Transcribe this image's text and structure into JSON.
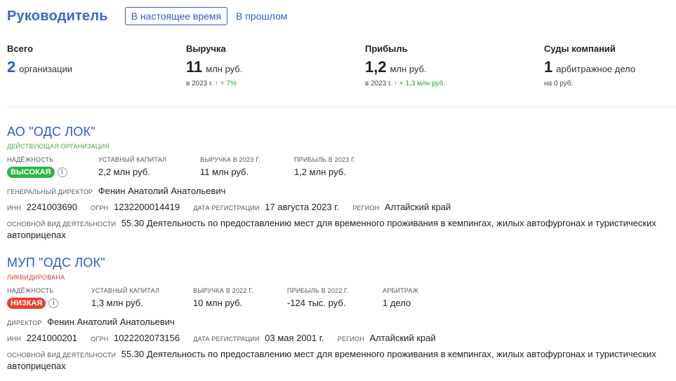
{
  "header": {
    "title": "Руководитель",
    "tabs": [
      {
        "label": "В настоящее время"
      },
      {
        "label": "В прошлом"
      }
    ]
  },
  "stats": {
    "total": {
      "label": "Всего",
      "value": "2",
      "unit": "организации"
    },
    "revenue": {
      "label": "Выручка",
      "value": "11",
      "unit": "млн руб.",
      "year": "в 2023 г.",
      "delta": "↑ + 7%"
    },
    "profit": {
      "label": "Прибыль",
      "value": "1,2",
      "unit": "млн руб.",
      "year": "в 2023 г.",
      "delta": "↑ + 1,3 млн руб."
    },
    "courts": {
      "label": "Суды компаний",
      "value": "1",
      "unit": "арбитражное дело",
      "sub": "на 0 руб."
    }
  },
  "orgs": [
    {
      "name": "АО \"ОДС ЛОК\"",
      "status": "ДЕЙСТВУЮЩАЯ ОРГАНИЗАЦИЯ",
      "reliability_label": "НАДЁЖНОСТЬ",
      "reliability": "ВЫСОКАЯ",
      "capital_label": "УСТАВНЫЙ КАПИТАЛ",
      "capital": "2,2 млн руб.",
      "revenue_label": "ВЫРУЧКА В 2023 Г.",
      "revenue": "11 млн руб.",
      "profit_label": "ПРИБЫЛЬ В 2023 Г.",
      "profit": "1,2 млн руб.",
      "director_label": "ГЕНЕРАЛЬНЫЙ ДИРЕКТОР",
      "director": "Фенин Анатолий Анатольевич",
      "inn_label": "ИНН",
      "inn": "2241003690",
      "ogrn_label": "ОГРН",
      "ogrn": "1232200014419",
      "regdate_label": "ДАТА РЕГИСТРАЦИИ",
      "regdate": "17 августа 2023 г.",
      "region_label": "РЕГИОН",
      "region": "Алтайский край",
      "activity_label": "ОСНОВНОЙ ВИД ДЕЯТЕЛЬНОСТИ",
      "activity": "55.30 Деятельность по предоставлению мест для временного проживания в кемпингах, жилых автофургонах и туристических автоприцепах"
    },
    {
      "name": "МУП \"ОДС ЛОК\"",
      "status": "ЛИКВИДИРОВАНА",
      "reliability_label": "НАДЁЖНОСТЬ",
      "reliability": "НИЗКАЯ",
      "capital_label": "УСТАВНЫЙ КАПИТАЛ",
      "capital": "1,3 млн руб.",
      "revenue_label": "ВЫРУЧКА В 2022 Г.",
      "revenue": "10 млн руб.",
      "profit_label": "ПРИБЫЛЬ В 2022 Г.",
      "profit": "-124 тыс. руб.",
      "arbitration_label": "АРБИТРАЖ",
      "arbitration": "1 дело",
      "director_label": "ДИРЕКТОР",
      "director": "Фенин Анатолий Анатольевич",
      "inn_label": "ИНН",
      "inn": "2241000201",
      "ogrn_label": "ОГРН",
      "ogrn": "1022202073156",
      "regdate_label": "ДАТА РЕГИСТРАЦИИ",
      "regdate": "03 мая 2001 г.",
      "region_label": "РЕГИОН",
      "region": "Алтайский край",
      "activity_label": "ОСНОВНОЙ ВИД ДЕЯТЕЛЬНОСТИ",
      "activity": "55.30 Деятельность по предоставлению мест для временного проживания в кемпингах, жилых автофургонах и туристических автоприцепах"
    }
  ],
  "colors": {
    "accent": "#2a5bd7",
    "title": "#3f64c8",
    "positive": "#2bb744",
    "negative": "#e8402f"
  },
  "icons": {
    "info": "info-icon"
  }
}
